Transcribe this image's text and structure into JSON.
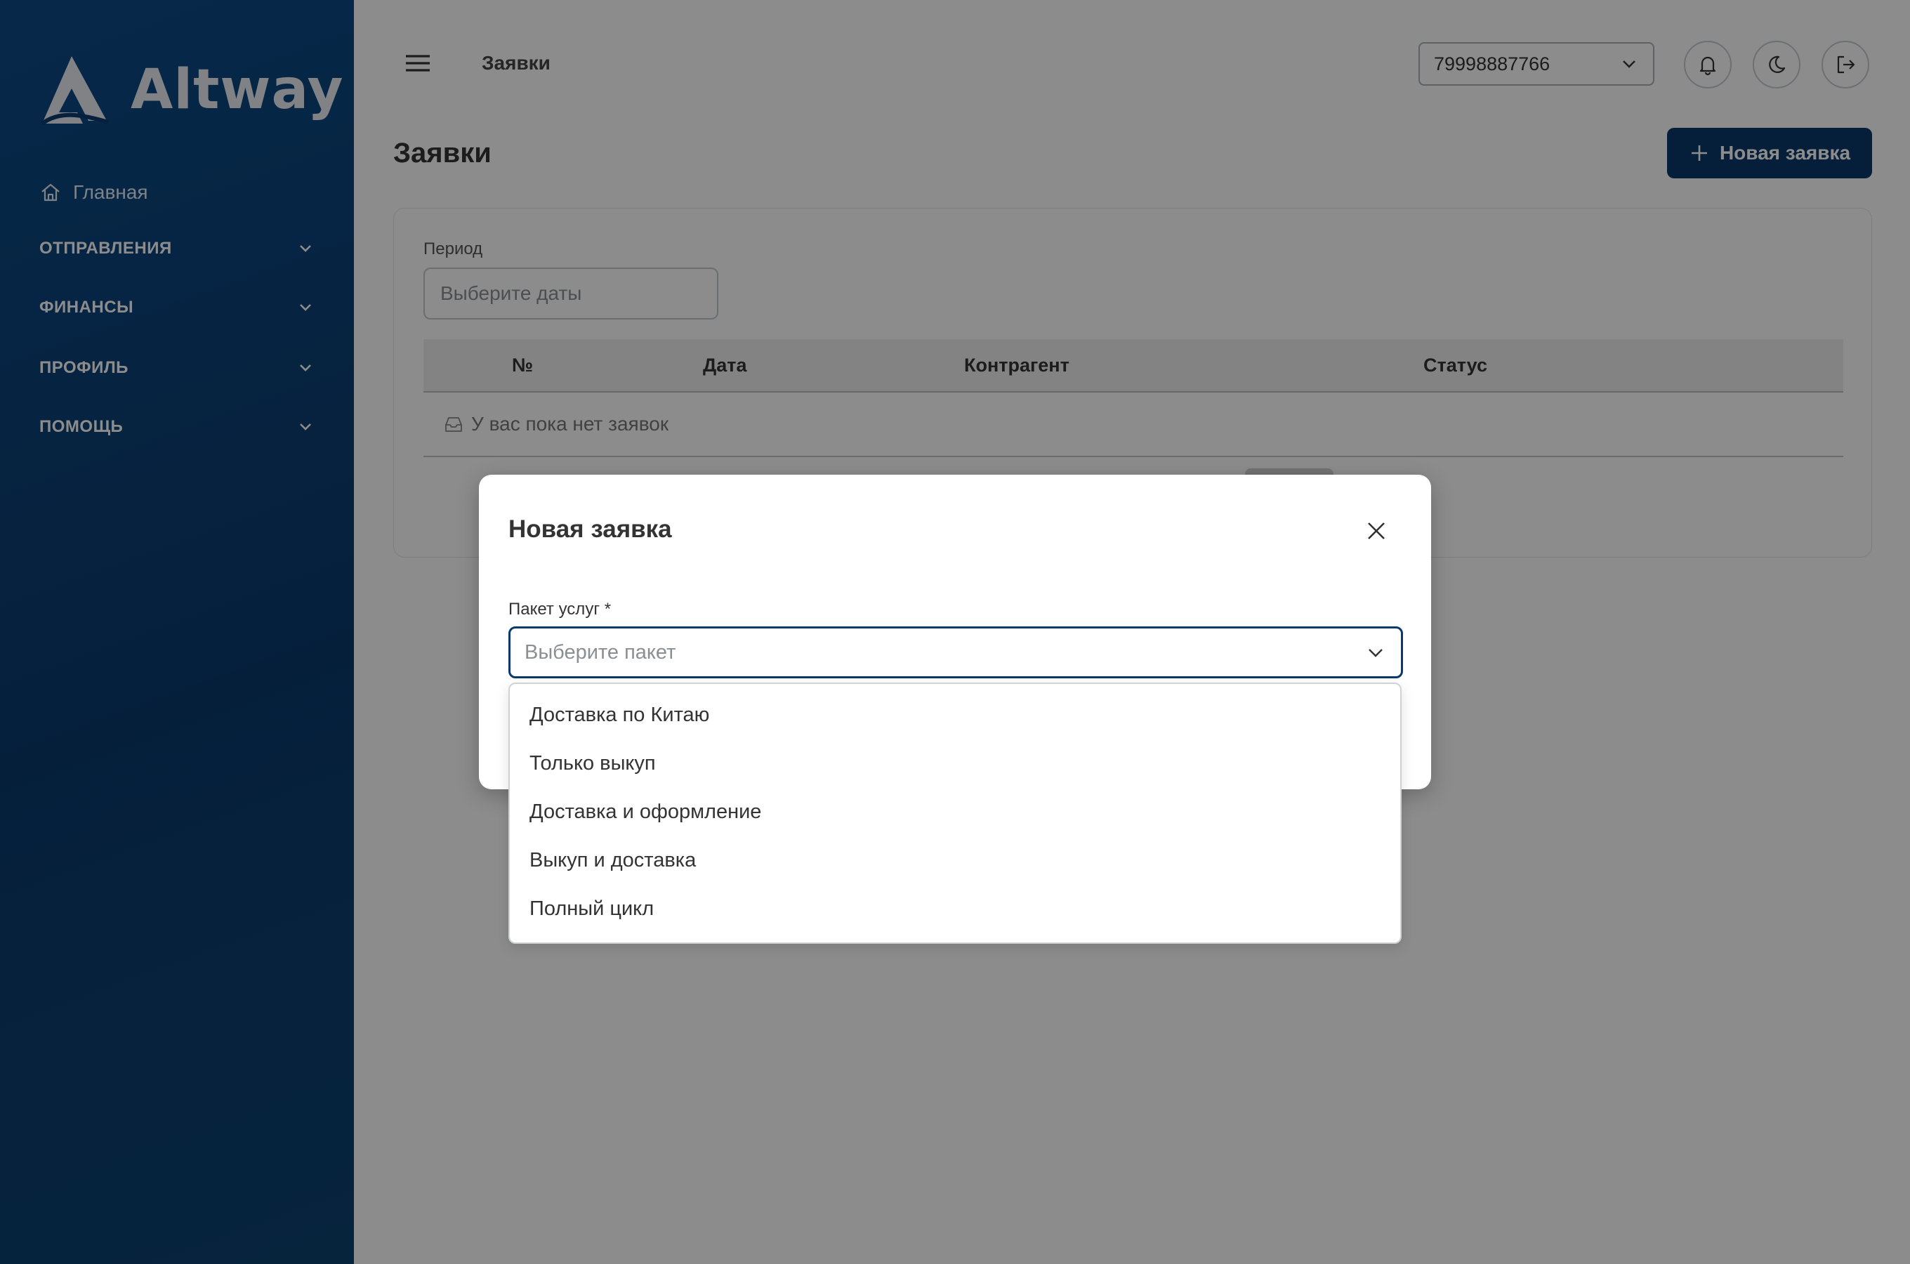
{
  "brand": {
    "name": "Altway"
  },
  "sidebar": {
    "home_label": "Главная",
    "groups": [
      {
        "label": "ОТПРАВЛЕНИЯ"
      },
      {
        "label": "ФИНАНСЫ"
      },
      {
        "label": "ПРОФИЛЬ"
      },
      {
        "label": "ПОМОЩЬ"
      }
    ]
  },
  "topbar": {
    "breadcrumb": "Заявки",
    "phone_value": "79998887766"
  },
  "page": {
    "title": "Заявки",
    "new_button_label": "Новая заявка"
  },
  "filters": {
    "period_label": "Период",
    "period_placeholder": "Выберите даты"
  },
  "table": {
    "columns": [
      "№",
      "Дата",
      "Контрагент",
      "Статус"
    ],
    "empty_text": "У вас пока нет заявок"
  },
  "modal": {
    "title": "Новая заявка",
    "field_label": "Пакет услуг *",
    "select_placeholder": "Выберите пакет",
    "options": [
      "Доставка по Китаю",
      "Только выкуп",
      "Доставка и оформление",
      "Выкуп и доставка",
      "Полный цикл"
    ]
  },
  "colors": {
    "primary": "#0a3a6c",
    "sidebar_bg": "#0b3d70",
    "overlay": "rgba(0,0,0,0.45)"
  }
}
